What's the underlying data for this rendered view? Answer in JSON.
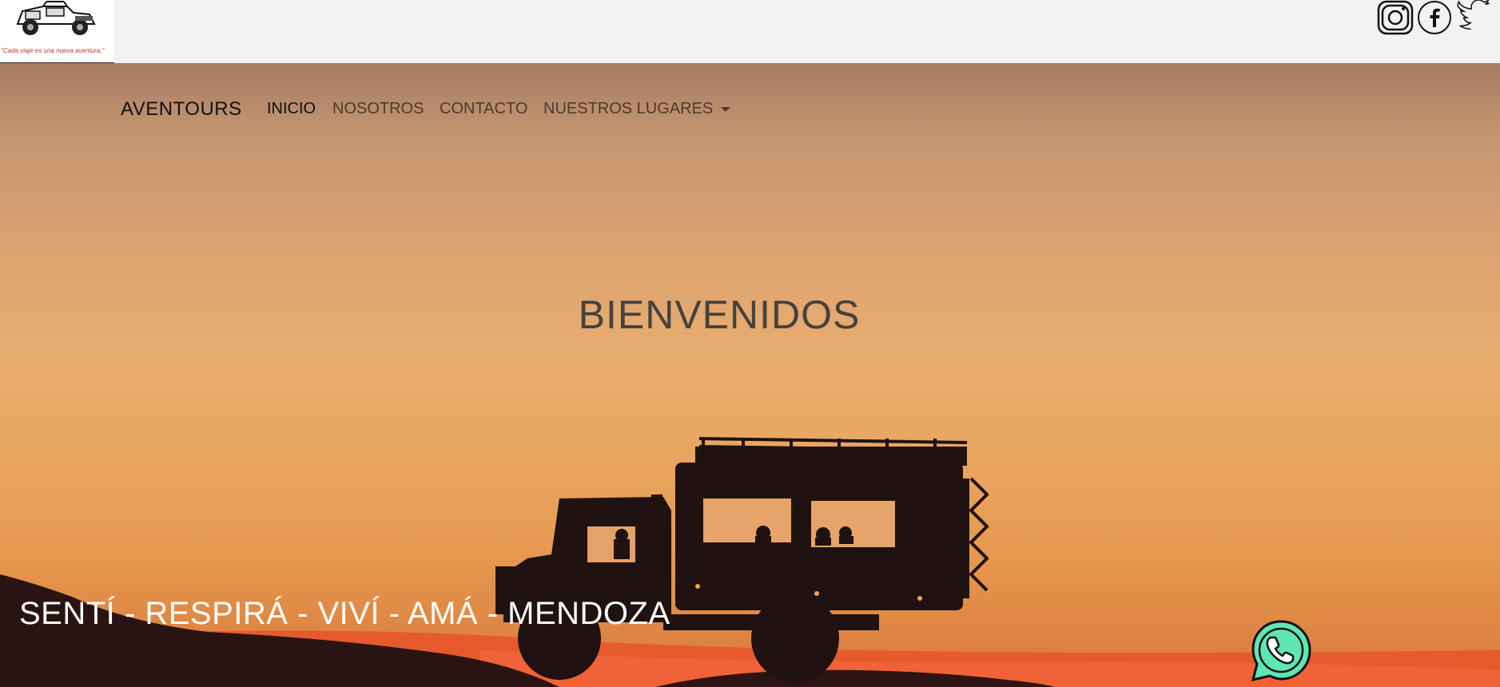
{
  "header": {
    "logo_tagline": "\"Cada viaje es una nueva aventura.\"",
    "social_icons": [
      "instagram-icon",
      "facebook-icon",
      "twitter-icon"
    ]
  },
  "nav": {
    "brand": "AVENTOURS",
    "links": [
      {
        "label": "INICIO",
        "active": true
      },
      {
        "label": "NOSOTROS",
        "active": false
      },
      {
        "label": "CONTACTO",
        "active": false
      },
      {
        "label": "NUESTROS LUGARES",
        "active": false,
        "dropdown": true
      }
    ]
  },
  "hero": {
    "title": "BIENVENIDOS",
    "motto": "SENTÍ - RESPIRÁ - VIVÍ - AMÁ - MENDOZA"
  },
  "floating": {
    "whatsapp_icon": "whatsapp-icon",
    "whatsapp_color": "#5ee6b5"
  },
  "colors": {
    "topbar_bg": "#f2f2f2",
    "sky_top": "#a57d64",
    "sky_mid": "#e9ad6d",
    "horizon": "#d9783a"
  }
}
